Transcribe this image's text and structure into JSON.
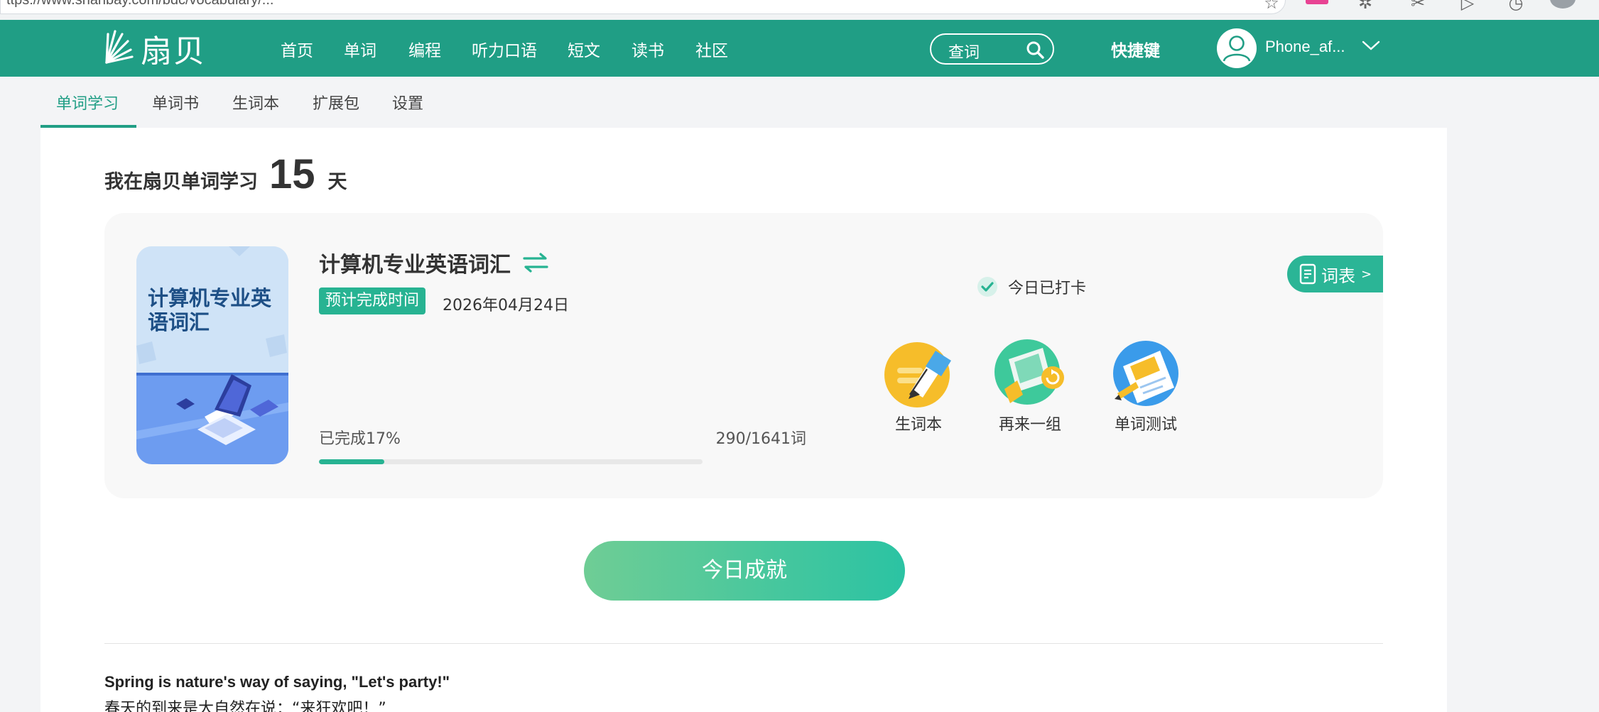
{
  "browser": {
    "url_fragment": "ttps://www.shanbay.com/bdc/vocabulary/..."
  },
  "topnav": {
    "logo_text": "扇贝",
    "items": [
      "首页",
      "单词",
      "编程",
      "听力口语",
      "短文",
      "读书",
      "社区"
    ],
    "search_label": "查词",
    "shortcut_label": "快捷键",
    "username": "Phone_af..."
  },
  "subnav": {
    "items": [
      "单词学习",
      "单词书",
      "生词本",
      "扩展包",
      "设置"
    ],
    "active_index": 0
  },
  "streak": {
    "prefix": "我在扇贝单词学习",
    "days": "15",
    "suffix": "天"
  },
  "book": {
    "cover_title": "计算机专业英语词汇",
    "title": "计算机专业英语词汇",
    "eta_label": "预计完成时间",
    "eta_date": "2026年04月24日",
    "progress_label": "已完成17%",
    "progress_count": "290/1641词",
    "progress_fraction": 0.17
  },
  "checkin": {
    "label": "今日已打卡"
  },
  "wordlist": {
    "label": "词表",
    "arrow": ">"
  },
  "actions": [
    {
      "label": "生词本",
      "icon": "notebook-pen-icon"
    },
    {
      "label": "再来一组",
      "icon": "repeat-set-icon"
    },
    {
      "label": "单词测试",
      "icon": "word-test-icon"
    }
  ],
  "achievement_button": "今日成就",
  "quote": {
    "en": "Spring is nature's way of saying, \"Let's party!\"",
    "zh": "春天的到来是大自然在说：“来狂欢吧！”"
  },
  "colors": {
    "brand": "#209e85",
    "accent": "#27b392"
  }
}
